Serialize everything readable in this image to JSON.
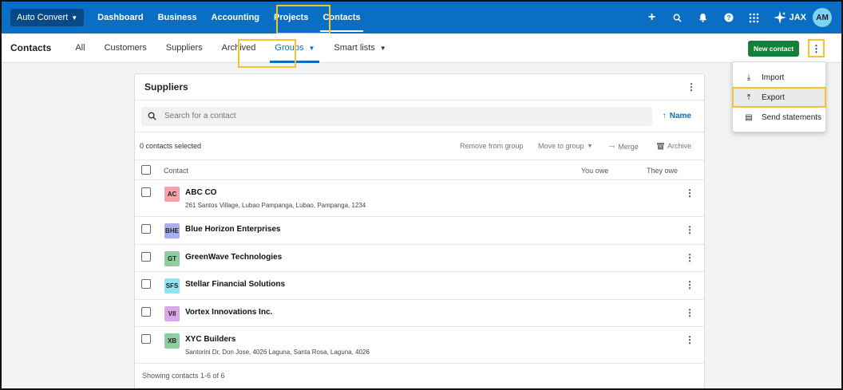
{
  "topnav": {
    "org_label": "Auto Convert",
    "links": [
      "Dashboard",
      "Business",
      "Accounting",
      "Projects",
      "Contacts"
    ],
    "jax_label": "JAX",
    "avatar_initials": "AM"
  },
  "subnav": {
    "title": "Contacts",
    "tabs": [
      "All",
      "Customers",
      "Suppliers",
      "Archived",
      "Groups",
      "Smart lists"
    ],
    "new_contact_label": "New contact"
  },
  "dropdown": {
    "items": [
      "Import",
      "Export",
      "Send statements"
    ]
  },
  "card": {
    "title": "Suppliers",
    "search_placeholder": "Search for a contact",
    "sort_label": "Name",
    "selected_text": "0 contacts selected",
    "actions": [
      "Remove from group",
      "Move to group",
      "Merge",
      "Archive"
    ],
    "columns": [
      "Contact",
      "You owe",
      "They owe"
    ],
    "rows": [
      {
        "initials": "AC",
        "name": "ABC CO",
        "address": "261 Santos Village, Lubao Pampanga, Lubao, Pampanga, 1234",
        "color": "#f4a3a8"
      },
      {
        "initials": "BHE",
        "name": "Blue Horizon Enterprises",
        "address": "",
        "color": "#a9aef0"
      },
      {
        "initials": "GT",
        "name": "GreenWave Technologies",
        "address": "",
        "color": "#8fcca0"
      },
      {
        "initials": "SFS",
        "name": "Stellar Financial Solutions",
        "address": "",
        "color": "#8ee4f2"
      },
      {
        "initials": "VII",
        "name": "Vortex Innovations Inc.",
        "address": "",
        "color": "#d9a8e6"
      },
      {
        "initials": "XB",
        "name": "XYC Builders",
        "address": "Santorini Dr, Don Jose, 4026 Laguna, Santa Rosa, Laguna, 4026",
        "color": "#8fcca0"
      }
    ],
    "footer": "Showing contacts 1-6 of 6"
  }
}
